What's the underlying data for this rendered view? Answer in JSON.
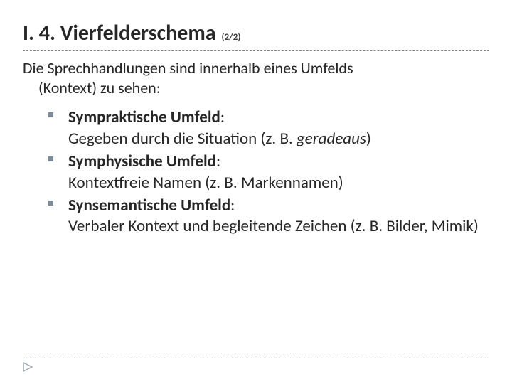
{
  "header": {
    "title": "I. 4. Vierfelderschema",
    "page_indicator": "(2/2)"
  },
  "intro": {
    "line1": "Die Sprechhandlungen sind innerhalb eines Umfelds",
    "line2": "(Kontext) zu sehen:"
  },
  "bullets": [
    {
      "term": "Sympraktische Umfeld",
      "colon": ":",
      "desc_pre": "Gegeben durch die Situation (z. B. ",
      "desc_em": "geradeaus",
      "desc_post": ")"
    },
    {
      "term": "Symphysische Umfeld",
      "colon": ":",
      "desc_pre": "Kontextfreie Namen (z. B. Markennamen)",
      "desc_em": "",
      "desc_post": ""
    },
    {
      "term": "Synsemantische Umfeld",
      "colon": ":",
      "desc_pre": "Verbaler Kontext und begleitende Zeichen (z. B. Bilder, Mimik)",
      "desc_em": "",
      "desc_post": ""
    }
  ]
}
